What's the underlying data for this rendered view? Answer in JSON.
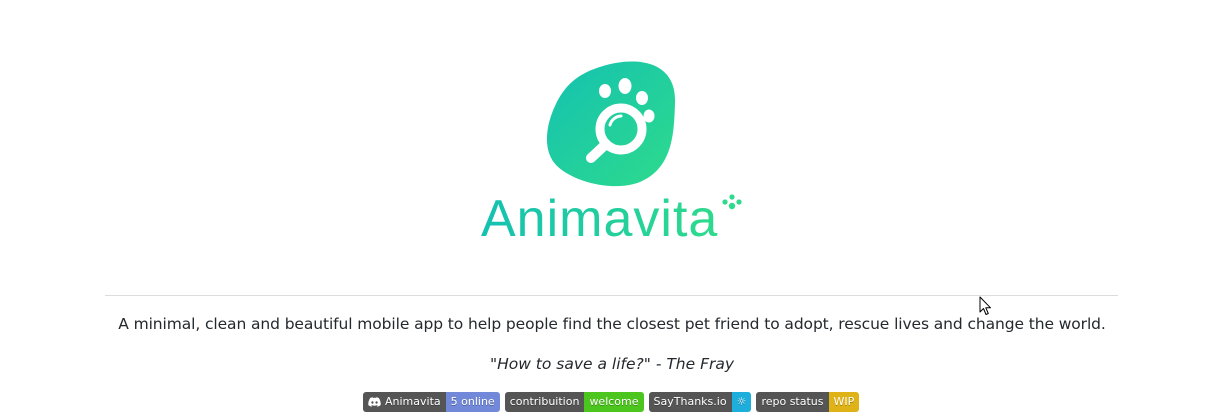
{
  "logo": {
    "wordmark": "Animavita",
    "icon": "paw-magnifier-icon",
    "colors": {
      "gradient_start": "#14c1b1",
      "gradient_end": "#2edb8c",
      "text": "#1fc9a0"
    }
  },
  "tagline": "A minimal, clean and beautiful mobile app to help people find the closest pet friend to adopt, rescue lives and change the world.",
  "quote": "\"How to save a life?\" - The Fray",
  "badges": [
    {
      "label": "Animavita",
      "value": "5 online",
      "icon": "discord-icon",
      "color": "#7289da"
    },
    {
      "label": "contribuition",
      "value": "welcome",
      "color": "#4cc61e"
    },
    {
      "label": "SayThanks.io",
      "value": "☼",
      "color": "#1eaedb"
    },
    {
      "label": "repo status",
      "value": "WIP",
      "color": "#dfb317"
    }
  ]
}
